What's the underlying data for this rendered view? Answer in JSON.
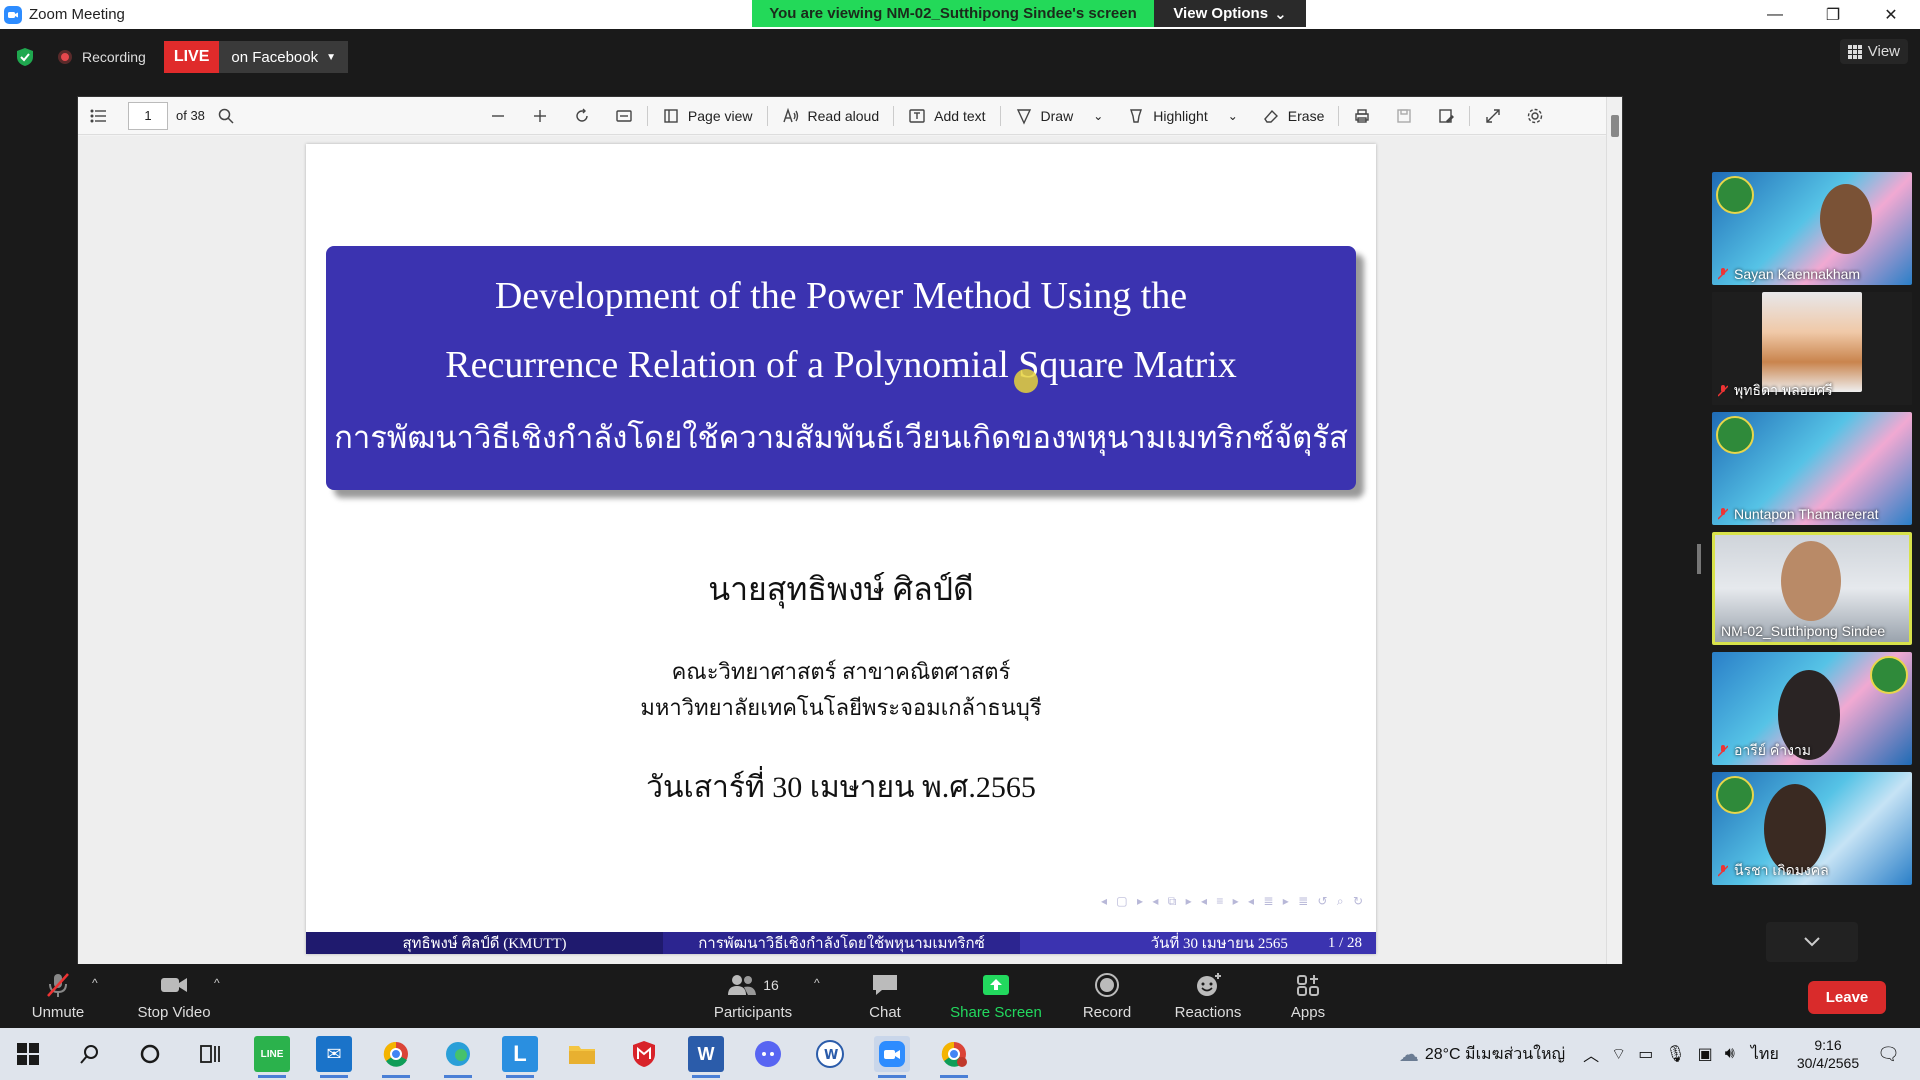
{
  "window": {
    "title": "Zoom Meeting",
    "viewing_banner": "You are viewing NM-02_Sutthipong Sindee's screen",
    "view_options": "View Options"
  },
  "meeting_top": {
    "recording": "Recording",
    "live": "LIVE",
    "live_target": "on Facebook",
    "view": "View"
  },
  "pdf_toolbar": {
    "page_current": "1",
    "page_total": "of 38",
    "page_view": "Page view",
    "read_aloud": "Read aloud",
    "add_text": "Add text",
    "draw": "Draw",
    "highlight": "Highlight",
    "erase": "Erase"
  },
  "slide": {
    "title_line1": "Development of the Power Method Using the",
    "title_line2": "Recurrence Relation of a Polynomial Square Matrix",
    "title_thai": "การพัฒนาวิธีเชิงกำลังโดยใช้ความสัมพันธ์เวียนเกิดของพหุนามเมทริกซ์จัตุรัส",
    "author": "นายสุทธิพงษ์   ศิลป์ดี",
    "affiliation1": "คณะวิทยาศาสตร์ สาขาคณิตศาสตร์",
    "affiliation2": "มหาวิทยาลัยเทคโนโลยีพระจอมเกล้าธนบุรี",
    "date": "วันเสาร์ที่ 30 เมษายน พ.ศ.2565",
    "footer_author": "สุทธิพงษ์ ศิลป์ดี  (KMUTT)",
    "footer_title": "การพัฒนาวิธีเชิงกำลังโดยใช้พหุนามเมทริกซ์",
    "footer_date": "วันที่ 30 เมษายน 2565",
    "footer_page": "1 / 28"
  },
  "participants_gallery": [
    {
      "name": "Sayan Kaennakham",
      "muted": true
    },
    {
      "name": "พุทธิดา พลอยศรี",
      "muted": true
    },
    {
      "name": "Nuntapon Thamareerat",
      "muted": true
    },
    {
      "name": "NM-02_Sutthipong Sindee",
      "muted": false,
      "active": true
    },
    {
      "name": "อารีย์ คำงาม",
      "muted": true
    },
    {
      "name": "นีรชา เกิดมงคล",
      "muted": true
    }
  ],
  "controls": {
    "unmute": "Unmute",
    "stop_video": "Stop Video",
    "participants": "Participants",
    "participants_count": "16",
    "chat": "Chat",
    "share_screen": "Share Screen",
    "record": "Record",
    "reactions": "Reactions",
    "apps": "Apps",
    "leave": "Leave"
  },
  "taskbar": {
    "weather": "28°C  มีเมฆส่วนใหญ่",
    "language": "ไทย",
    "time": "9:16",
    "date": "30/4/2565"
  },
  "colors": {
    "zoom_blue": "#2d8cff",
    "banner_green": "#23d959",
    "slide_blue": "#3b33b0",
    "leave_red": "#d92b2b",
    "active_speaker": "#d8e24b"
  }
}
